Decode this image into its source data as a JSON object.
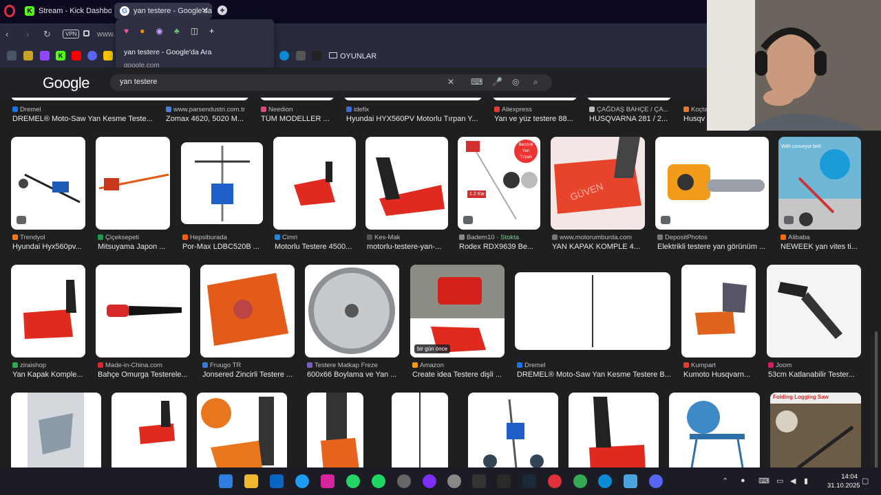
{
  "browser": {
    "tabs": [
      {
        "label": "Stream - Kick Dashboard",
        "icon": "kick-icon",
        "color": "#53fc18"
      },
      {
        "label": "yan testere - Google'da Ara",
        "icon": "google-icon",
        "color": "#4285f4"
      }
    ],
    "address": {
      "vpn_label": "VPN",
      "url": "www."
    },
    "bookmarks": {
      "folder_label": "OYUNLAR"
    },
    "hover_popup": {
      "title": "yan testere - Google'da Ara",
      "domain": "google.com"
    }
  },
  "google": {
    "logo": "Google",
    "query": "yan testere"
  },
  "results": {
    "row0": [
      {
        "source": "Dremel",
        "title": "DREMEL® Moto-Saw Yan Kesme Teste..."
      },
      {
        "source": "www.parsendustri.com.tr",
        "title": "Zomax 4620, 5020 M..."
      },
      {
        "source": "Needion",
        "title": "TÜM MODELLER ..."
      },
      {
        "source": "idefix",
        "title": "Hyundai HYX560PV Motorlu Tırpan Y..."
      },
      {
        "source": "Aliexpress",
        "title": "Yan ve yüz testere 88..."
      },
      {
        "source": "ÇAĞDAŞ BAHÇE / ÇA...",
        "title": "HUSQVARNA 281 / 2..."
      },
      {
        "source": "Koçta",
        "title": "Husqv"
      }
    ],
    "row1": [
      {
        "source": "Trendyol",
        "title": "Hyundai Hyx560pv..."
      },
      {
        "source": "Çiçeksepeti",
        "title": "Mitsuyama Japon ..."
      },
      {
        "source": "Hepsiburada",
        "title": "Por-Max LDBC520B ..."
      },
      {
        "source": "Cimri",
        "title": "Motorlu Testere 4500..."
      },
      {
        "source": "Kes-Mak",
        "title": "motorlu-testere-yan-..."
      },
      {
        "source": "Badem10 · ",
        "stock": "Stokta",
        "title": "Rodex RDX9639 Be..."
      },
      {
        "source": "www.motorumburda.com",
        "title": "YAN KAPAK KOMPLE 4..."
      },
      {
        "source": "DepositPhotos",
        "title": "Elektrikli testere yan görünüm ..."
      },
      {
        "source": "Alibaba",
        "title": "NEWEEK yan vites ti..."
      }
    ],
    "row2": [
      {
        "source": "ziraishop",
        "title": "Yan Kapak Komple..."
      },
      {
        "source": "Made-in-China.com",
        "title": "Bahçe Omurga Testerele..."
      },
      {
        "source": "Fruugo TR",
        "title": "Jonsered Zincirli Testere ..."
      },
      {
        "source": "Testere Matkap Freze",
        "title": "600x66 Boylama ve Yan ..."
      },
      {
        "source": "Amazon",
        "title": "Create idea Testere dişli ...",
        "tag": "bir gün önce"
      },
      {
        "source": "Dremel",
        "title": "DREMEL® Moto-Saw Yan Kesme Testere B..."
      },
      {
        "source": "Kumpart",
        "title": "Kumoto Husqvarn..."
      },
      {
        "source": "Joom",
        "title": "53cm Katlanabilir Tester..."
      }
    ],
    "row3_caption": "Folding Logging Saw",
    "promo_text": {
      "l1": "Benzinli",
      "l2": "Yan",
      "l3": "Tırpan",
      "power": "1.2 Kw",
      "brand": "GÜVEN",
      "note": "With conveyor belt"
    }
  },
  "taskbar": {
    "time": "14:04",
    "date": "31.10.2025"
  }
}
